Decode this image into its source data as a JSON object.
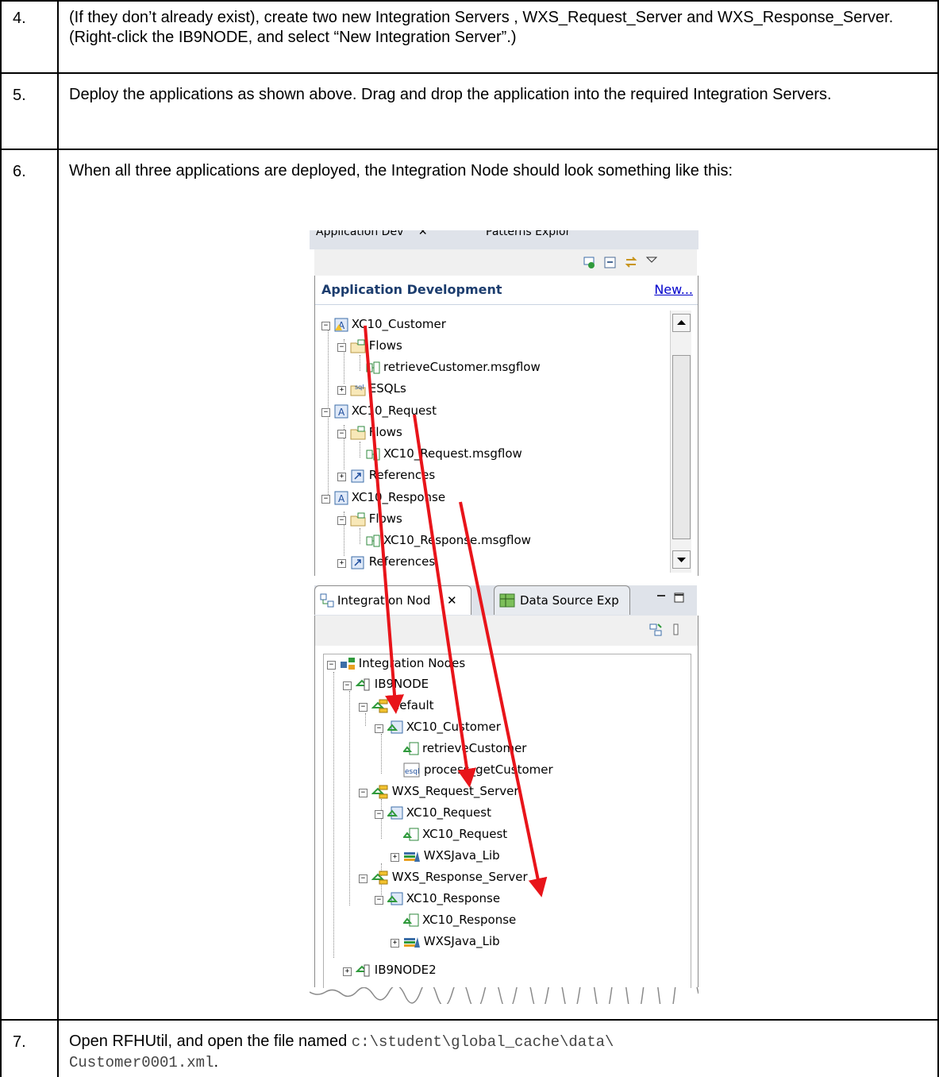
{
  "steps": [
    {
      "num": "4.",
      "text": "(If they don’t already exist), create two new Integration Servers , WXS_Request_Server and WXS_Response_Server. (Right-click the IB9NODE, and select “New Integration Server”.)"
    },
    {
      "num": "5.",
      "text": "Deploy the applications as shown above. Drag and drop the application into the required Integration Servers."
    },
    {
      "num": "6.",
      "text": "When all three applications are deployed, the Integration Node should look something like this:"
    },
    {
      "num": "7.",
      "text_before": "Open RFHUtil, and open the file named ",
      "code_path": "c:\\student\\global_cache\\data\\",
      "code_file": "Customer0001.xml",
      "text_after": "."
    }
  ],
  "screenshot": {
    "top_tabs": [
      {
        "label": "Application Dev",
        "close": "✕"
      },
      {
        "label": "Patterns Explor"
      }
    ],
    "app_dev": {
      "header": "Application Development",
      "new_link": "New...",
      "tree": [
        {
          "label": "XC10_Customer",
          "icon": "application-icon"
        },
        {
          "label": "Flows",
          "icon": "folder-flows-icon"
        },
        {
          "label": "retrieveCustomer.msgflow",
          "icon": "msgflow-icon"
        },
        {
          "label": "ESQLs",
          "icon": "esql-folder-icon"
        },
        {
          "label": "XC10_Request",
          "icon": "application-icon"
        },
        {
          "label": "Flows",
          "icon": "folder-flows-icon"
        },
        {
          "label": "XC10_Request.msgflow",
          "icon": "msgflow-icon"
        },
        {
          "label": "References",
          "icon": "references-icon"
        },
        {
          "label": "XC10_Response",
          "icon": "application-icon"
        },
        {
          "label": "Flows",
          "icon": "folder-flows-icon"
        },
        {
          "label": "XC10_Response.msgflow",
          "icon": "msgflow-icon"
        },
        {
          "label": "References",
          "icon": "references-icon"
        }
      ]
    },
    "bottom_tabs": [
      {
        "label": "Integration Nod",
        "close": "✕"
      },
      {
        "label": "Data Source Exp"
      }
    ],
    "integration_nodes": {
      "tree": [
        {
          "label": "Integration Nodes",
          "icon": "integration-nodes-icon"
        },
        {
          "label": "IB9NODE",
          "icon": "node-icon"
        },
        {
          "label": "default",
          "icon": "server-icon"
        },
        {
          "label": "XC10_Customer",
          "icon": "deployed-app-icon"
        },
        {
          "label": "retrieveCustomer",
          "icon": "deployed-flow-icon"
        },
        {
          "label": "process_getCustomer",
          "icon": "esql-file-icon"
        },
        {
          "label": "WXS_Request_Server",
          "icon": "server-icon"
        },
        {
          "label": "XC10_Request",
          "icon": "deployed-app-icon"
        },
        {
          "label": "XC10_Request",
          "icon": "deployed-flow-icon"
        },
        {
          "label": "WXSJava_Lib",
          "icon": "library-icon"
        },
        {
          "label": "WXS_Response_Server",
          "icon": "server-icon"
        },
        {
          "label": "XC10_Response",
          "icon": "deployed-app-icon"
        },
        {
          "label": "XC10_Response",
          "icon": "deployed-flow-icon"
        },
        {
          "label": "WXSJava_Lib",
          "icon": "library-icon"
        },
        {
          "label": "IB9NODE2",
          "icon": "node-icon"
        }
      ]
    },
    "arrow_color": "#e8141a"
  }
}
